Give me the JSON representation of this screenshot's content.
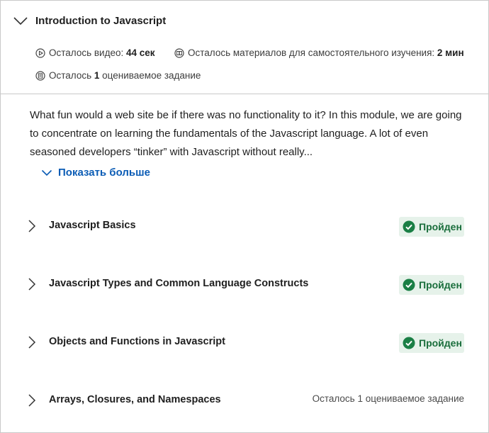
{
  "module": {
    "title": "Introduction to Javascript",
    "meta": {
      "video_prefix": "Осталось видео:",
      "video_value": "44 сек",
      "reading_prefix": "Осталось материалов для самостоятельного изучения:",
      "reading_value": "2 мин",
      "graded_prefix": "Осталось",
      "graded_count": "1",
      "graded_suffix": "оцениваемое задание"
    },
    "description": "What fun would a web site be if there was no functionality to it? In this module, we are going to concentrate on learning the fundamentals of the Javascript language. A lot of even seasoned developers “tinker” with Javascript without really...",
    "show_more_label": "Показать больше"
  },
  "lessons": [
    {
      "title": "Javascript Basics",
      "status": "Пройден",
      "completed": true
    },
    {
      "title": "Javascript Types and Common Language Constructs",
      "status": "Пройден",
      "completed": true
    },
    {
      "title": "Objects and Functions in Javascript",
      "status": "Пройден",
      "completed": true
    },
    {
      "title": "Arrays, Closures, and Namespaces",
      "status": "Осталось 1 оцениваемое задание",
      "completed": false
    }
  ],
  "colors": {
    "link": "#0b5cb5",
    "badge_bg": "#e6f2ea",
    "badge_text": "#1a6e3c",
    "check": "#1a7f45",
    "border": "#c9c9c9"
  },
  "icons": {
    "collapse": "chevron-down-icon",
    "lesson_expand": "chevron-right-icon",
    "video": "play-circle-icon",
    "reading": "reading-icon",
    "graded": "assignment-icon",
    "completed": "check-circle-icon"
  }
}
